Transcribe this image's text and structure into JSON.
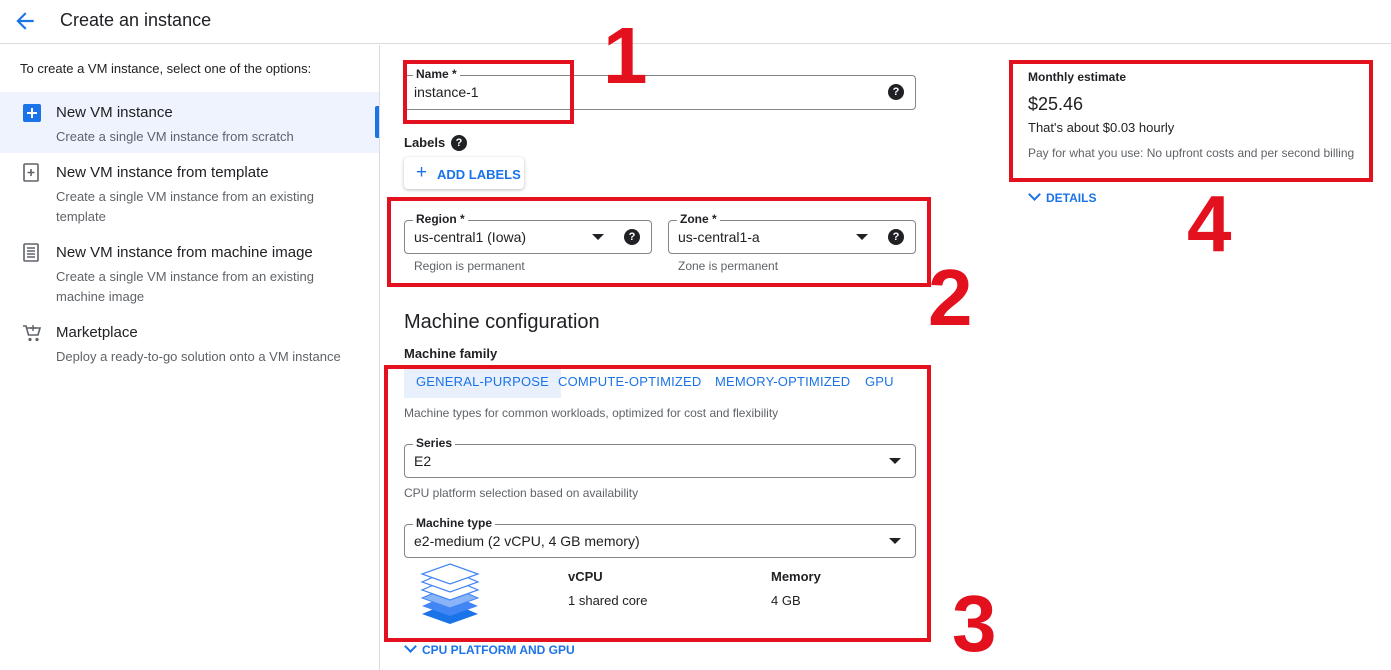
{
  "header": {
    "title": "Create an instance",
    "back_icon": "arrow-back-icon"
  },
  "sidebar": {
    "intro": "To create a VM instance, select one of the options:",
    "items": [
      {
        "title": "New VM instance",
        "desc": "Create a single VM instance from scratch",
        "icon": "add-box-icon",
        "active": true
      },
      {
        "title": "New VM instance from template",
        "desc": "Create a single VM instance from an existing template",
        "icon": "template-add-icon",
        "active": false
      },
      {
        "title": "New VM instance from machine image",
        "desc": "Create a single VM instance from an existing machine image",
        "icon": "machine-image-icon",
        "active": false
      },
      {
        "title": "Marketplace",
        "desc": "Deploy a ready-to-go solution onto a VM instance",
        "icon": "cart-icon",
        "active": false
      }
    ]
  },
  "form": {
    "name": {
      "label": "Name *",
      "value": "instance-1"
    },
    "labels": {
      "title": "Labels",
      "add_button": "ADD LABELS"
    },
    "region": {
      "label": "Region *",
      "value": "us-central1 (Iowa)",
      "hint": "Region is permanent"
    },
    "zone": {
      "label": "Zone *",
      "value": "us-central1-a",
      "hint": "Zone is permanent"
    },
    "help_glyph": "?"
  },
  "machine": {
    "section_title": "Machine configuration",
    "family_label": "Machine family",
    "tabs": [
      "GENERAL-PURPOSE",
      "COMPUTE-OPTIMIZED",
      "MEMORY-OPTIMIZED",
      "GPU"
    ],
    "active_tab": "GENERAL-PURPOSE",
    "family_desc": "Machine types for common workloads, optimized for cost and flexibility",
    "series": {
      "label": "Series",
      "value": "E2",
      "hint": "CPU platform selection based on availability"
    },
    "type": {
      "label": "Machine type",
      "value": "e2-medium (2 vCPU, 4 GB memory)"
    },
    "specs": {
      "vcpu_header": "vCPU",
      "vcpu_value": "1 shared core",
      "memory_header": "Memory",
      "memory_value": "4 GB"
    },
    "cpu_platform_expander": "CPU PLATFORM AND GPU"
  },
  "estimate": {
    "label": "Monthly estimate",
    "price": "$25.46",
    "hourly": "That's about $0.03 hourly",
    "note": "Pay for what you use: No upfront costs and per second billing",
    "details": "DETAILS"
  },
  "annotations": [
    "1",
    "2",
    "3",
    "4"
  ],
  "colors": {
    "accent": "#1a73e8",
    "annotation": "#e3101d",
    "active_bg": "#eef3fd"
  }
}
